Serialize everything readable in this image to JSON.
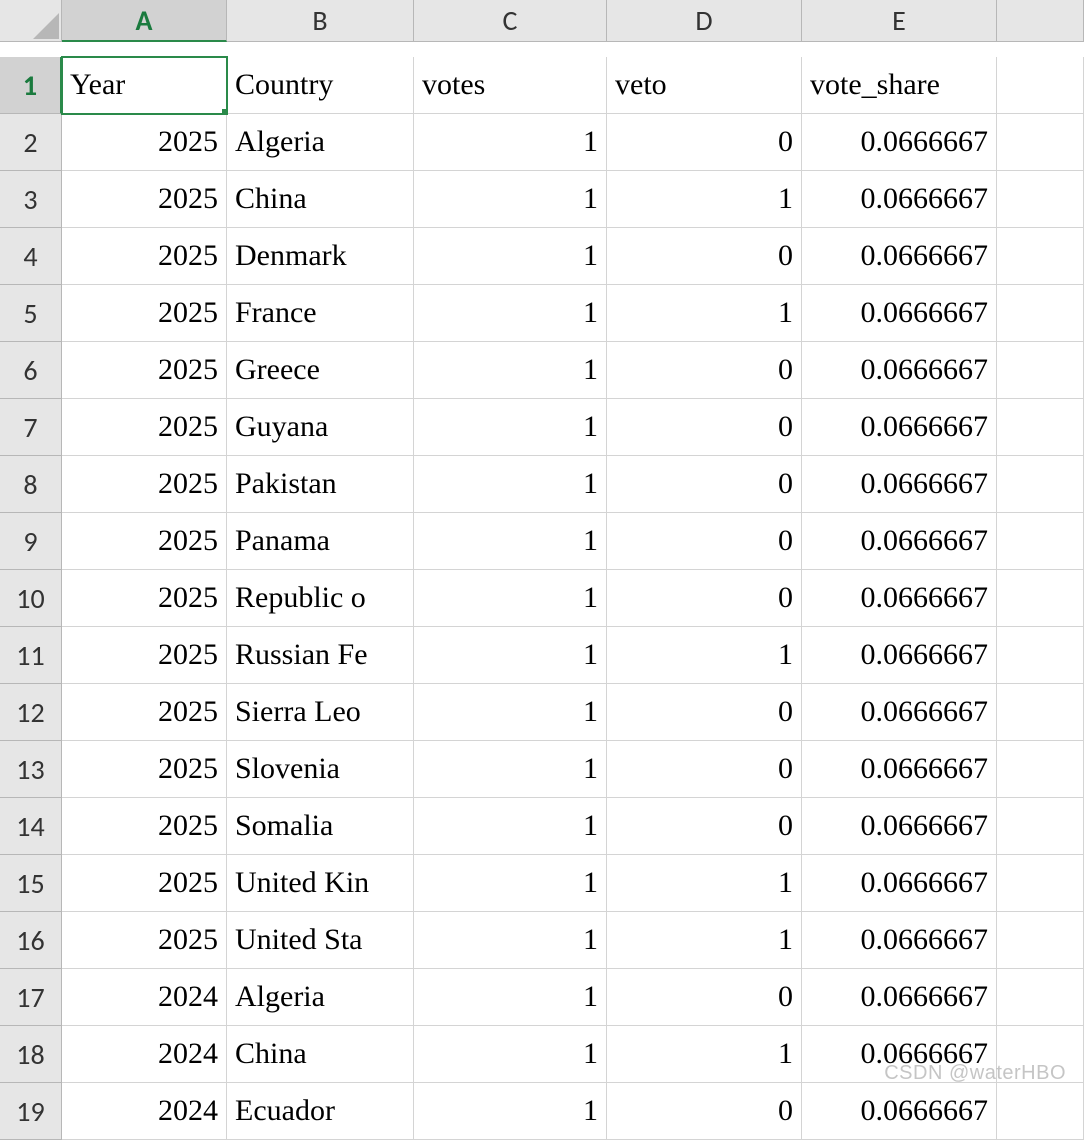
{
  "columns": [
    "A",
    "B",
    "C",
    "D",
    "E"
  ],
  "headers": {
    "A": "Year",
    "B": "Country",
    "C": "votes",
    "D": "veto",
    "E": "vote_share"
  },
  "selected_cell": "A1",
  "rows": [
    {
      "n": 2,
      "A": "2025",
      "B": "Algeria",
      "C": "1",
      "D": "0",
      "E": "0.0666667"
    },
    {
      "n": 3,
      "A": "2025",
      "B": "China",
      "C": "1",
      "D": "1",
      "E": "0.0666667"
    },
    {
      "n": 4,
      "A": "2025",
      "B": "Denmark",
      "C": "1",
      "D": "0",
      "E": "0.0666667"
    },
    {
      "n": 5,
      "A": "2025",
      "B": "France",
      "C": "1",
      "D": "1",
      "E": "0.0666667"
    },
    {
      "n": 6,
      "A": "2025",
      "B": "Greece",
      "C": "1",
      "D": "0",
      "E": "0.0666667"
    },
    {
      "n": 7,
      "A": "2025",
      "B": "Guyana",
      "C": "1",
      "D": "0",
      "E": "0.0666667"
    },
    {
      "n": 8,
      "A": "2025",
      "B": "Pakistan",
      "C": "1",
      "D": "0",
      "E": "0.0666667"
    },
    {
      "n": 9,
      "A": "2025",
      "B": "Panama",
      "C": "1",
      "D": "0",
      "E": "0.0666667"
    },
    {
      "n": 10,
      "A": "2025",
      "B": "Republic o",
      "C": "1",
      "D": "0",
      "E": "0.0666667"
    },
    {
      "n": 11,
      "A": "2025",
      "B": "Russian Fe",
      "C": "1",
      "D": "1",
      "E": "0.0666667"
    },
    {
      "n": 12,
      "A": "2025",
      "B": "Sierra Leo",
      "C": "1",
      "D": "0",
      "E": "0.0666667"
    },
    {
      "n": 13,
      "A": "2025",
      "B": "Slovenia",
      "C": "1",
      "D": "0",
      "E": "0.0666667"
    },
    {
      "n": 14,
      "A": "2025",
      "B": "Somalia",
      "C": "1",
      "D": "0",
      "E": "0.0666667"
    },
    {
      "n": 15,
      "A": "2025",
      "B": "United Kin",
      "C": "1",
      "D": "1",
      "E": "0.0666667"
    },
    {
      "n": 16,
      "A": "2025",
      "B": "United Sta",
      "C": "1",
      "D": "1",
      "E": "0.0666667"
    },
    {
      "n": 17,
      "A": "2024",
      "B": "Algeria",
      "C": "1",
      "D": "0",
      "E": "0.0666667"
    },
    {
      "n": 18,
      "A": "2024",
      "B": "China",
      "C": "1",
      "D": "1",
      "E": "0.0666667"
    },
    {
      "n": 19,
      "A": "2024",
      "B": "Ecuador",
      "C": "1",
      "D": "0",
      "E": "0.0666667"
    }
  ],
  "watermark": "CSDN @waterHBO"
}
